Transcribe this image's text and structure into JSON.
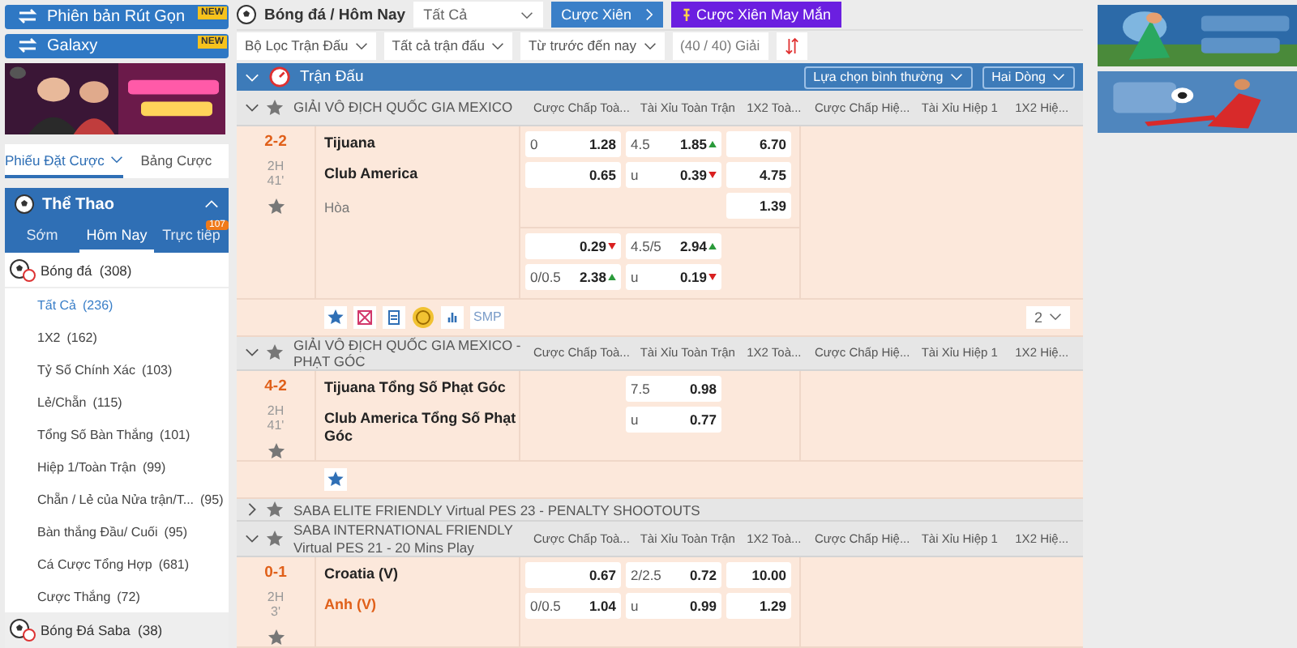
{
  "sidebar": {
    "quick_buttons": [
      {
        "label": "Phiên bản Rút Gọn",
        "badge": "NEW"
      },
      {
        "label": "Galaxy",
        "badge": "NEW"
      }
    ],
    "bet_tabs": [
      {
        "label": "Phiếu Đặt Cược",
        "selected": true
      },
      {
        "label": "Bảng Cược",
        "selected": false
      }
    ],
    "sports": {
      "title": "Thể Thao",
      "expanded": true,
      "tabs": [
        {
          "label": "Sớm",
          "selected": false
        },
        {
          "label": "Hôm Nay",
          "selected": true
        },
        {
          "label": "Trực tiếp",
          "selected": false,
          "badge": "107"
        }
      ],
      "items": [
        {
          "label": "Bóng đá",
          "count": "(308)",
          "children": [
            {
              "label": "Tất Cả",
              "count": "(236)",
              "selected": true
            },
            {
              "label": "1X2",
              "count": "(162)",
              "selected": false
            },
            {
              "label": "Tỷ Số Chính Xác",
              "count": "(103)",
              "selected": false
            },
            {
              "label": "Lẻ/Chẵn",
              "count": "(115)",
              "selected": false
            },
            {
              "label": "Tổng Số Bàn Thắng",
              "count": "(101)",
              "selected": false
            },
            {
              "label": "Hiệp 1/Toàn Trận",
              "count": "(99)",
              "selected": false
            },
            {
              "label": "Chẵn / Lẻ của Nửa trận/T...",
              "count": "(95)",
              "selected": false
            },
            {
              "label": "Bàn thắng Đầu/ Cuối",
              "count": "(95)",
              "selected": false
            },
            {
              "label": "Cá Cược Tổng Hợp",
              "count": "(681)",
              "selected": false
            },
            {
              "label": "Cược Thắng",
              "count": "(72)",
              "selected": false
            }
          ]
        },
        {
          "label": "Bóng Đá Saba",
          "count": "(38)"
        }
      ]
    }
  },
  "header": {
    "title": "Bóng đá / Hôm Nay",
    "market": "Tất Cả",
    "parlay": "Cược Xiên",
    "lucky_parlay": "Cược Xiên May Mắn"
  },
  "filters": [
    "Bộ Lọc Trận Đấu",
    "Tất cả trận đấu",
    "Từ trước đến nay"
  ],
  "league_count": "(40 / 40) Giải",
  "section": {
    "title": "Trận Đấu",
    "expanded": true,
    "odds_type": "Lựa chọn bình thường",
    "display": "Hai Dòng"
  },
  "leagues": [
    {
      "name": "GIẢI VÔ ĐỊCH QUỐC GIA MEXICO",
      "expanded": true,
      "favorite": false,
      "columns": [
        "Cược Chấp Toà...",
        "Tài Xỉu Toàn Trận",
        "1X2 Toà...",
        "Cược Chấp Hiệ...",
        "Tài Xỉu Hiệp 1",
        "1X2 Hiệ..."
      ],
      "matches": [
        {
          "score": "2-2",
          "period": "2H",
          "minute": "41'",
          "favorite": false,
          "teams": [
            {
              "name": "Tijuana",
              "highlight": false
            },
            {
              "name": "Club America",
              "highlight": false
            }
          ],
          "draw": "Hòa",
          "groups": [
            [
              {
                "hdp": {
                  "line": "0",
                  "odds": "1.28"
                },
                "ou": {
                  "line": "4.5",
                  "odds": "1.85",
                  "rising": true
                },
                "x12": {
                  "odds": "6.70"
                }
              },
              {
                "hdp": {
                  "odds": "0.65"
                },
                "ou": {
                  "line": "u",
                  "odds": "0.39",
                  "rising": false
                },
                "x12": {
                  "odds": "4.75"
                }
              },
              {
                "x12": {
                  "odds": "1.39"
                }
              }
            ],
            [
              {
                "hdp": {
                  "odds": "0.29",
                  "rising": false
                },
                "ou": {
                  "line": "4.5/5",
                  "odds": "2.94",
                  "rising": true
                }
              },
              {
                "hdp": {
                  "line": "0/0.5",
                  "odds": "2.38",
                  "rising": true
                },
                "ou": {
                  "line": "u",
                  "odds": "0.19",
                  "rising": false
                }
              }
            ]
          ],
          "tools": [
            {
              "kind": "star"
            },
            {
              "kind": "scoreboard"
            },
            {
              "kind": "list"
            },
            {
              "kind": "coin"
            },
            {
              "kind": "stats"
            },
            {
              "kind": "text",
              "label": "SMP"
            }
          ],
          "more": "2"
        }
      ]
    },
    {
      "name": "GIẢI VÔ ĐỊCH QUỐC GIA MEXICO - PHẠT GÓC",
      "expanded": true,
      "favorite": false,
      "columns": [
        "Cược Chấp Toà...",
        "Tài Xỉu Toàn Trận",
        "1X2 Toà...",
        "Cược Chấp Hiệ...",
        "Tài Xỉu Hiệp 1",
        "1X2 Hiệ..."
      ],
      "matches": [
        {
          "score": "4-2",
          "period": "2H",
          "minute": "41'",
          "favorite": false,
          "teams": [
            {
              "name": "Tijuana Tổng Số Phạt Góc",
              "highlight": false
            },
            {
              "name": "Club America Tổng Số Phạt Góc",
              "highlight": false
            }
          ],
          "groups": [
            [
              {
                "ou": {
                  "line": "7.5",
                  "odds": "0.98"
                }
              },
              {
                "ou": {
                  "line": "u",
                  "odds": "0.77"
                }
              }
            ]
          ],
          "tools": [
            {
              "kind": "star"
            }
          ]
        }
      ]
    },
    {
      "name": "SABA ELITE FRIENDLY Virtual PES 23 - PENALTY SHOOTOUTS",
      "expanded": false,
      "favorite": false
    },
    {
      "name": "SABA INTERNATIONAL FRIENDLY Virtual PES 21 - 20 Mins Play",
      "expanded": true,
      "favorite": false,
      "columns": [
        "Cược Chấp Toà...",
        "Tài Xỉu Toàn Trận",
        "1X2 Toà...",
        "Cược Chấp Hiệ...",
        "Tài Xỉu Hiệp 1",
        "1X2 Hiệ..."
      ],
      "matches": [
        {
          "score": "0-1",
          "period": "2H",
          "minute": "3'",
          "favorite": false,
          "teams": [
            {
              "name": "Croatia (V)",
              "highlight": false
            },
            {
              "name": "Anh (V)",
              "highlight": true
            }
          ],
          "groups": [
            [
              {
                "hdp": {
                  "odds": "0.67"
                },
                "ou": {
                  "line": "2/2.5",
                  "odds": "0.72"
                },
                "x12": {
                  "odds": "10.00"
                }
              },
              {
                "hdp": {
                  "line": "0/0.5",
                  "odds": "1.04"
                },
                "ou": {
                  "line": "u",
                  "odds": "0.99"
                },
                "x12": {
                  "odds": "1.29"
                }
              }
            ]
          ]
        }
      ]
    }
  ]
}
